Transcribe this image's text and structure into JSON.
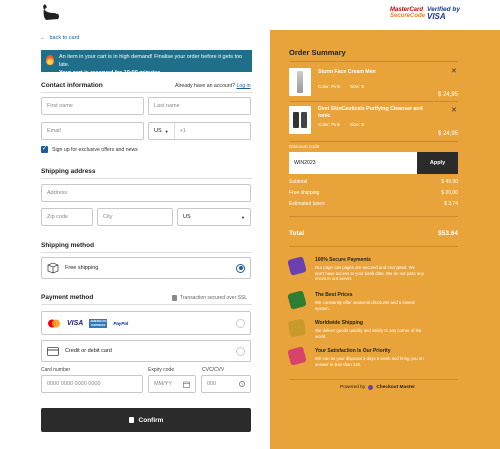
{
  "header": {
    "mastercard": {
      "line1": "MasterCard",
      "line2": "SecureCode"
    },
    "visa": {
      "line1": "Verified by",
      "line2": "VISA"
    }
  },
  "back_link": "back to card",
  "alert": {
    "line1": "An item in your cart is in high demand! Finalise your order before it gets too late.",
    "line2": "Your cart is reserved for 10:00 minutes."
  },
  "contact": {
    "title": "Contact information",
    "account_prompt": "Already have an account?",
    "login_link": "Log in",
    "first_name_placeholder": "First name",
    "last_name_placeholder": "Last name",
    "email_placeholder": "Email",
    "country_code": "US",
    "phone_placeholder": "+1",
    "signup_label": "Sign up for exclusive offers and news"
  },
  "shipping_address": {
    "title": "Shipping address",
    "address_placeholder": "Address",
    "zip_placeholder": "Zip code",
    "city_placeholder": "City",
    "country": "US"
  },
  "shipping_method": {
    "title": "Shipping method",
    "option": "Free shipping"
  },
  "payment": {
    "title": "Payment method",
    "secure_note": "Transaction secured over SSL",
    "card_brands": [
      "MasterCard",
      "VISA",
      "American Express",
      "PayPal"
    ],
    "card_option": "Credit or debit card",
    "card_number_label": "Card number",
    "card_number_placeholder": "0000  0000  0000  0000",
    "expiry_label": "Expiry code",
    "expiry_placeholder": "MM/YY",
    "cvc_label": "CVC/CVV",
    "cvc_placeholder": "000"
  },
  "confirm_button": "Confirm",
  "summary": {
    "title": "Order Summary",
    "items": [
      {
        "name": "Sturm Face Cream Men",
        "color": "Color: Pink",
        "size": "Size: S",
        "price": "$ 24,95"
      },
      {
        "name": "Dvet SkinCeuticals Purifying Cleanser and tonic",
        "color": "Color: Pink",
        "size": "Size: S",
        "price": "$ 24,95"
      }
    ],
    "discount_label": "Discount code",
    "discount_value": "WIN2023",
    "apply_label": "Apply",
    "subtotal_label": "Subtotal",
    "subtotal_value": "$ 49.90",
    "shipping_label": "Free shipping",
    "shipping_value": "$ 00,00",
    "taxes_label": "Estimated taxes",
    "taxes_value": "$ 3.74",
    "total_label": "Total",
    "total_value": "$53.64"
  },
  "features": [
    {
      "title": "100% Secure Payments",
      "text": "Our page can pages are secured and encrypted. We don't have access to your bank data. We do not pass any errors in our server.",
      "color": "#6a3fb0"
    },
    {
      "title": "The Best Prices",
      "text": "We constantly offer seasonal discounts and a lowest system.",
      "color": "#2e7d32"
    },
    {
      "title": "Worldwide Shipping",
      "text": "We deliver goods quickly and safely to any corner of the world.",
      "color": "#c79a2a"
    },
    {
      "title": "Your Satisfaction Is Our Priority",
      "text": "We can as your disposal 3 days a week and bring you an answer in less than 24h.",
      "color": "#d8436b"
    }
  ],
  "powered_by": {
    "prefix": "Powered by",
    "brand": "Checkout Master"
  }
}
